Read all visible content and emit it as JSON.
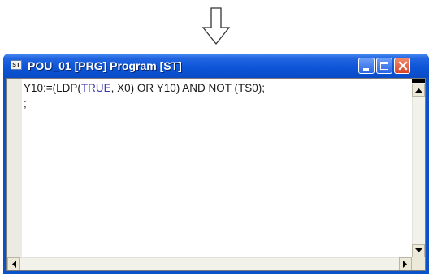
{
  "window": {
    "title": "POU_01 [PRG] Program [ST]",
    "app_icon_text": "ST"
  },
  "editor": {
    "line1_prefix": "Y10:=(LDP(",
    "line1_keyword": "TRUE",
    "line1_suffix": ", X0) OR Y10) AND NOT (TS0);",
    "line2": ";"
  },
  "icons": {
    "arrow": "down-arrow-icon",
    "minimize": "minimize-icon",
    "maximize": "maximize-icon",
    "close": "close-icon"
  },
  "colors": {
    "titlebar": "#0a52c8",
    "keyword": "#3c3cb4",
    "close_button": "#d8452a"
  }
}
